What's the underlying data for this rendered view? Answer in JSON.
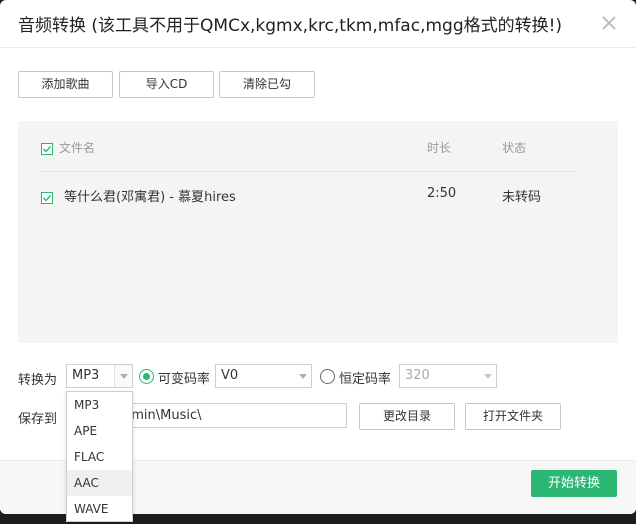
{
  "window": {
    "title": "音频转换 (该工具不用于QMCx,kgmx,krc,tkm,mfac,mgg格式的转换!)"
  },
  "toolbar": {
    "add_label": "添加歌曲",
    "import_cd_label": "导入CD",
    "clear_checked_label": "清除已勾"
  },
  "table": {
    "columns": {
      "filename": "文件名",
      "duration": "时长",
      "status": "状态"
    },
    "rows": [
      {
        "checked": true,
        "name": "等什么君(邓寓君) - 慕夏hires",
        "duration": "2:50",
        "status": "未转码"
      }
    ]
  },
  "convert": {
    "label": "转换为",
    "format": "MP3",
    "vbr_label": "可变码率",
    "vbr_value": "V0",
    "cbr_label": "恒定码率",
    "cbr_value": "320",
    "selected_mode": "vbr"
  },
  "save": {
    "label": "保存到",
    "path": "dmin\\Music\\",
    "change_dir_label": "更改目录",
    "open_folder_label": "打开文件夹"
  },
  "footer": {
    "start_label": "开始转换"
  },
  "format_dropdown": {
    "options": [
      "MP3",
      "APE",
      "FLAC",
      "AAC",
      "WAVE"
    ],
    "hovered": "AAC"
  },
  "colors": {
    "accent": "#2bb673",
    "panel_bg": "#f4f4f4"
  }
}
